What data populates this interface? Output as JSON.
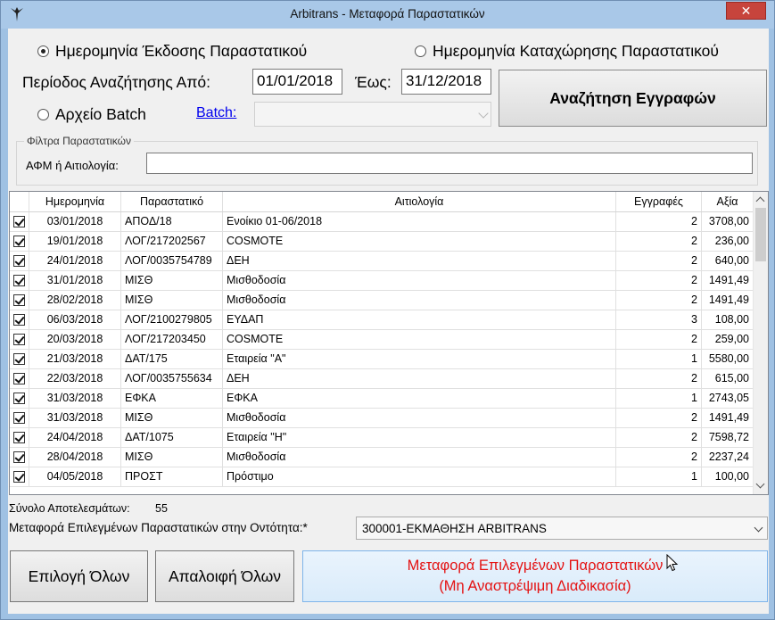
{
  "window": {
    "title": "Arbitrans - Μεταφορά Παραστατικών",
    "close_label": "✕"
  },
  "search": {
    "radio_issue_date": "Ημερομηνία Έκδοσης Παραστατικού",
    "radio_register_date": "Ημερομηνία Καταχώρησης Παραστατικού",
    "period_from_label": "Περίοδος Αναζήτησης Από:",
    "from_value": "01/01/2018",
    "to_label": "Έως:",
    "to_value": "31/12/2018",
    "radio_batch": "Αρχείο Batch",
    "batch_link": "Batch:",
    "search_button": "Αναζήτηση Εγγραφών",
    "selected_mode": "issue_date"
  },
  "filters": {
    "group_title": "Φίλτρα Παραστατικών",
    "afm_label": "ΑΦΜ ή Αιτιολογία:",
    "afm_value": ""
  },
  "grid": {
    "columns": [
      "",
      "Ημερομηνία",
      "Παραστατικό",
      "Αιτιολογία",
      "Εγγραφές",
      "Αξία"
    ],
    "rows": [
      {
        "checked": true,
        "date": "03/01/2018",
        "doc": "ΑΠΟΔ/18",
        "reason": "Ενοίκιο 01-06/2018",
        "entries": "2",
        "value": "3708,00"
      },
      {
        "checked": true,
        "date": "19/01/2018",
        "doc": "ΛΟΓ/217202567",
        "reason": "COSMOTE",
        "entries": "2",
        "value": "236,00"
      },
      {
        "checked": true,
        "date": "24/01/2018",
        "doc": "ΛΟΓ/0035754789",
        "reason": "ΔΕΗ",
        "entries": "2",
        "value": "640,00"
      },
      {
        "checked": true,
        "date": "31/01/2018",
        "doc": "ΜΙΣΘ",
        "reason": "Μισθοδοσία",
        "entries": "2",
        "value": "1491,49"
      },
      {
        "checked": true,
        "date": "28/02/2018",
        "doc": "ΜΙΣΘ",
        "reason": "Μισθοδοσία",
        "entries": "2",
        "value": "1491,49"
      },
      {
        "checked": true,
        "date": "06/03/2018",
        "doc": "ΛΟΓ/2100279805",
        "reason": "ΕΥΔΑΠ",
        "entries": "3",
        "value": "108,00"
      },
      {
        "checked": true,
        "date": "20/03/2018",
        "doc": "ΛΟΓ/217203450",
        "reason": "COSMOTE",
        "entries": "2",
        "value": "259,00"
      },
      {
        "checked": true,
        "date": "21/03/2018",
        "doc": "ΔΑΤ/175",
        "reason": "Εταιρεία \"Α\"",
        "entries": "1",
        "value": "5580,00"
      },
      {
        "checked": true,
        "date": "22/03/2018",
        "doc": "ΛΟΓ/0035755634",
        "reason": "ΔΕΗ",
        "entries": "2",
        "value": "615,00"
      },
      {
        "checked": true,
        "date": "31/03/2018",
        "doc": "ΕΦΚΑ",
        "reason": "ΕΦΚΑ",
        "entries": "1",
        "value": "2743,05"
      },
      {
        "checked": true,
        "date": "31/03/2018",
        "doc": "ΜΙΣΘ",
        "reason": "Μισθοδοσία",
        "entries": "2",
        "value": "1491,49"
      },
      {
        "checked": true,
        "date": "24/04/2018",
        "doc": "ΔΑΤ/1075",
        "reason": "Εταιρεία \"Η\"",
        "entries": "2",
        "value": "7598,72"
      },
      {
        "checked": true,
        "date": "28/04/2018",
        "doc": "ΜΙΣΘ",
        "reason": "Μισθοδοσία",
        "entries": "2",
        "value": "2237,24"
      },
      {
        "checked": true,
        "date": "04/05/2018",
        "doc": "ΠΡΟΣΤ",
        "reason": "Πρόστιμο",
        "entries": "1",
        "value": "100,00"
      }
    ]
  },
  "footer": {
    "total_label": "Σύνολο Αποτελεσμάτων:",
    "total_value": "55",
    "transfer_entity_label": "Μεταφορά Επιλεγμένων Παραστατικών στην Οντότητα:*",
    "entity_value": "300001-ΕΚΜΑΘΗΣΗ ARBITRANS",
    "select_all": "Επιλογή Όλων",
    "deselect_all": "Απαλοιφή Όλων",
    "transfer_line1": "Μεταφορά Επιλεγμένων Παραστατικών",
    "transfer_line2": "(Μη Αναστρέψιμη Διαδικασία)"
  }
}
